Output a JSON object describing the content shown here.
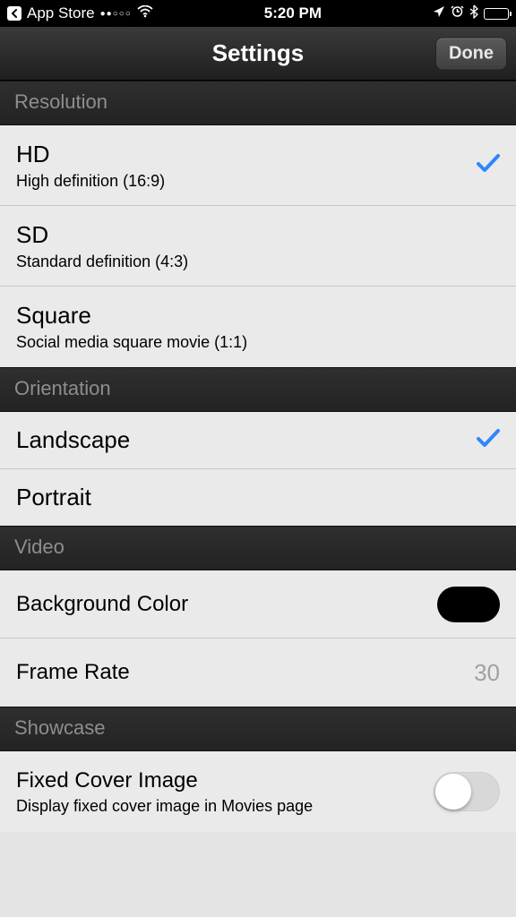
{
  "status": {
    "back_label": "App Store",
    "time": "5:20 PM"
  },
  "nav": {
    "title": "Settings",
    "done": "Done"
  },
  "sections": {
    "resolution": {
      "header": "Resolution",
      "items": [
        {
          "title": "HD",
          "subtitle": "High definition (16:9)",
          "selected": true
        },
        {
          "title": "SD",
          "subtitle": "Standard definition (4:3)",
          "selected": false
        },
        {
          "title": "Square",
          "subtitle": "Social media square movie (1:1)",
          "selected": false
        }
      ]
    },
    "orientation": {
      "header": "Orientation",
      "items": [
        {
          "title": "Landscape",
          "selected": true
        },
        {
          "title": "Portrait",
          "selected": false
        }
      ]
    },
    "video": {
      "header": "Video",
      "bg_color_label": "Background Color",
      "bg_color_value": "#000000",
      "frame_rate_label": "Frame Rate",
      "frame_rate_value": "30"
    },
    "showcase": {
      "header": "Showcase",
      "fixed_cover_label": "Fixed Cover Image",
      "fixed_cover_sub": "Display fixed cover image in Movies page",
      "fixed_cover_on": false
    }
  }
}
